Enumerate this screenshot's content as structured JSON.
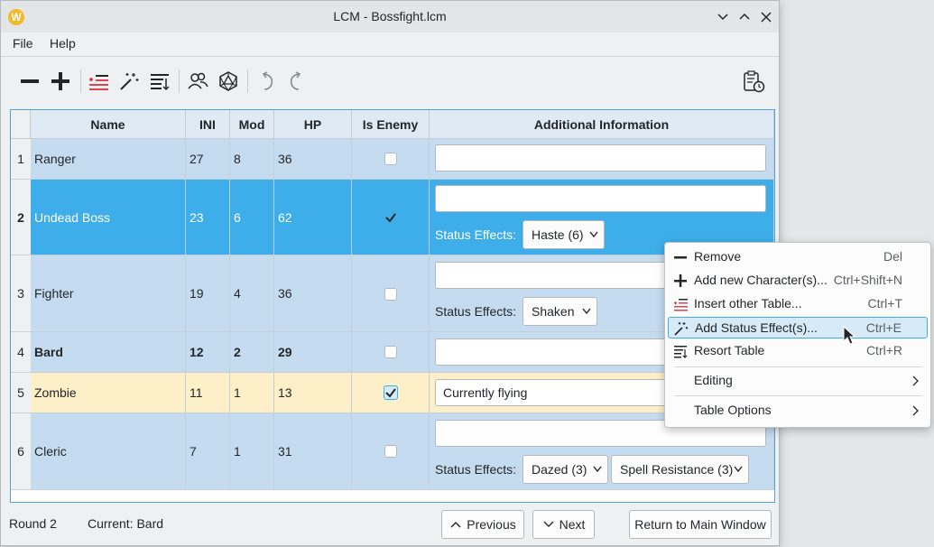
{
  "window": {
    "title": "LCM - Bossfight.lcm"
  },
  "menu": {
    "file": "File",
    "help": "Help"
  },
  "toolbar": [
    "remove-icon",
    "add-icon",
    "insert-table-icon",
    "status-effect-icon",
    "resort-icon",
    "characters-icon",
    "dice-icon",
    "undo-icon",
    "redo-icon",
    "timer-icon"
  ],
  "table": {
    "headers": {
      "name": "Name",
      "ini": "INI",
      "mod": "Mod",
      "hp": "HP",
      "enemy": "Is Enemy",
      "info": "Additional Information"
    },
    "status_label": "Status Effects:",
    "rows": [
      {
        "num": "1",
        "name": "Ranger",
        "ini": "27",
        "mod": "8",
        "hp": "36",
        "enemy": false,
        "info": ""
      },
      {
        "num": "2",
        "name": "Undead Boss",
        "ini": "23",
        "mod": "6",
        "hp": "62",
        "enemy": true,
        "info": "",
        "effects": [
          "Haste (6)"
        ]
      },
      {
        "num": "3",
        "name": "Fighter",
        "ini": "19",
        "mod": "4",
        "hp": "36",
        "enemy": false,
        "info": "",
        "effects": [
          "Shaken"
        ]
      },
      {
        "num": "4",
        "name": "Bard",
        "ini": "12",
        "mod": "2",
        "hp": "29",
        "enemy": false,
        "info": ""
      },
      {
        "num": "5",
        "name": "Zombie",
        "ini": "11",
        "mod": "1",
        "hp": "13",
        "enemy": true,
        "info": "Currently flying"
      },
      {
        "num": "6",
        "name": "Cleric",
        "ini": "7",
        "mod": "1",
        "hp": "31",
        "enemy": false,
        "info": "",
        "effects": [
          "Dazed (3)",
          "Spell Resistance (3)"
        ]
      }
    ]
  },
  "status": {
    "round": "Round 2",
    "current": "Current: Bard",
    "previous": "Previous",
    "next": "Next",
    "return": "Return to Main Window"
  },
  "context_menu": {
    "items": [
      {
        "label": "Remove",
        "shortcut": "Del"
      },
      {
        "label": "Add new Character(s)...",
        "shortcut": "Ctrl+Shift+N"
      },
      {
        "label": "Insert other Table...",
        "shortcut": "Ctrl+T"
      },
      {
        "label": "Add Status Effect(s)...",
        "shortcut": "Ctrl+E"
      },
      {
        "label": "Resort Table",
        "shortcut": "Ctrl+R"
      }
    ],
    "editing": "Editing",
    "table_options": "Table Options"
  },
  "colors": {
    "row": "#c5dcf0",
    "selected": "#3daee9",
    "current_row": "#fdf0c8",
    "accent": "#3daee9"
  }
}
